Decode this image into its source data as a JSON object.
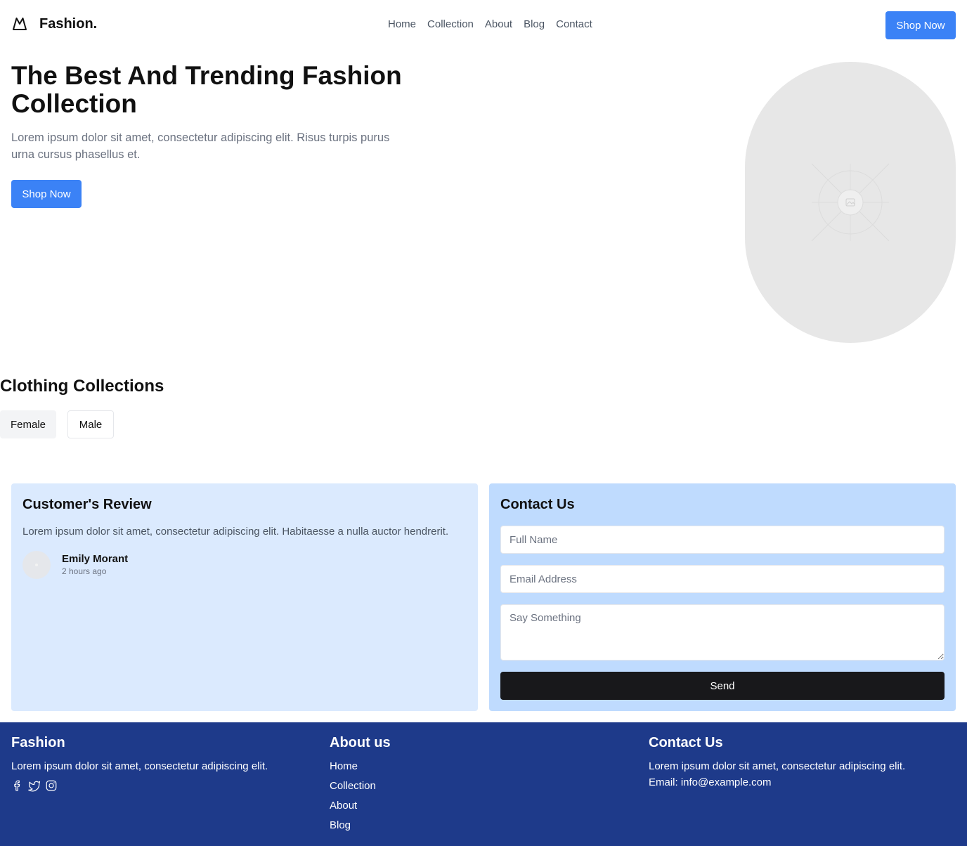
{
  "header": {
    "brand": "Fashion.",
    "nav": [
      "Home",
      "Collection",
      "About",
      "Blog",
      "Contact"
    ],
    "cta": "Shop Now"
  },
  "hero": {
    "title": "The Best And Trending Fashion Collection",
    "subtitle": "Lorem ipsum dolor sit amet, consectetur adipiscing elit. Risus turpis purus urna cursus phasellus et.",
    "cta": "Shop Now",
    "image_icon": "image-placeholder-icon"
  },
  "collections": {
    "title": "Clothing Collections",
    "tabs": [
      "Female",
      "Male"
    ],
    "active_tab": "Female"
  },
  "review": {
    "title": "Customer's Review",
    "text": "Lorem ipsum dolor sit amet, consectetur adipiscing elit. Habitaesse a nulla auctor hendrerit.",
    "name": "Emily Morant",
    "time": "2 hours ago"
  },
  "contact": {
    "title": "Contact Us",
    "name_placeholder": "Full Name",
    "email_placeholder": "Email Address",
    "message_placeholder": "Say Something",
    "send": "Send"
  },
  "footer": {
    "col1": {
      "title": "Fashion",
      "text": "Lorem ipsum dolor sit amet, consectetur adipiscing elit.",
      "social_icons": [
        "facebook-icon",
        "twitter-icon",
        "instagram-icon"
      ]
    },
    "col2": {
      "title": "About us",
      "links": [
        "Home",
        "Collection",
        "About",
        "Blog"
      ]
    },
    "col3": {
      "title": "Contact Us",
      "text": "Lorem ipsum dolor sit amet, consectetur adipiscing elit.",
      "email": "Email: info@example.com"
    }
  },
  "colors": {
    "primary": "#3b82f6",
    "review_bg": "#dbeafe",
    "contact_bg": "#bfdbfe",
    "footer_bg": "#1e3a8a",
    "send_bg": "#18181b"
  }
}
